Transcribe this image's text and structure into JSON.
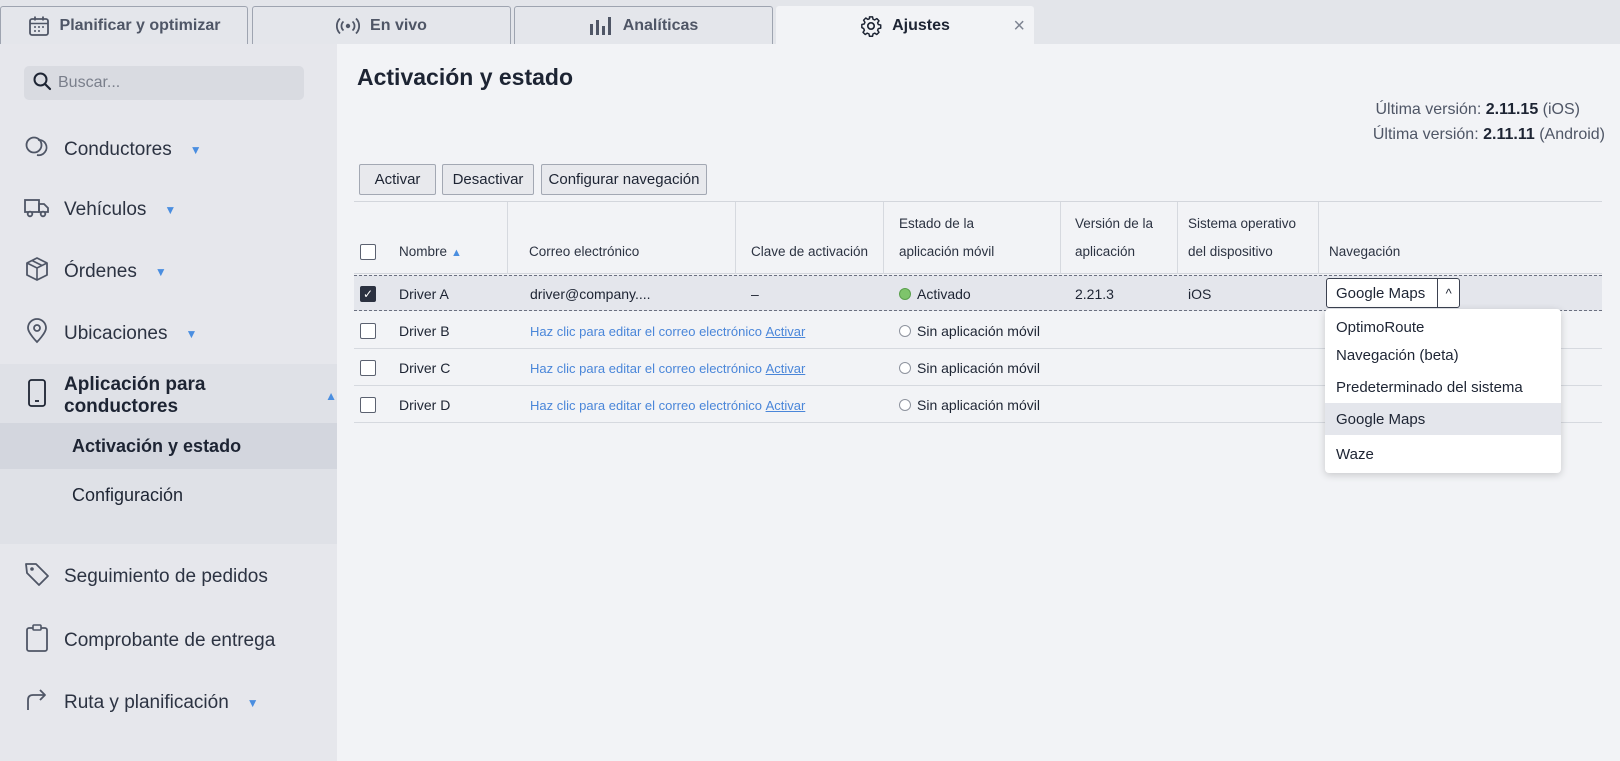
{
  "tabs": [
    {
      "label": "Planificar y optimizar",
      "icon": "calendar-icon"
    },
    {
      "label": "En vivo",
      "icon": "broadcast-icon"
    },
    {
      "label": "Analíticas",
      "icon": "bar-chart-icon"
    },
    {
      "label": "Ajustes",
      "icon": "gear-icon",
      "active": true
    }
  ],
  "sidebar": {
    "search_placeholder": "Buscar...",
    "items": [
      {
        "label": "Conductores",
        "icon": "drivers-icon"
      },
      {
        "label": "Vehículos",
        "icon": "truck-icon"
      },
      {
        "label": "Órdenes",
        "icon": "package-icon"
      },
      {
        "label": "Ubicaciones",
        "icon": "pin-icon"
      },
      {
        "label": "Aplicación para conductores",
        "icon": "phone-icon"
      },
      {
        "label": "Seguimiento de pedidos",
        "icon": "tag-icon"
      },
      {
        "label": "Comprobante de entrega",
        "icon": "clipboard-icon"
      },
      {
        "label": "Ruta y planificación",
        "icon": "route-arrow-icon"
      }
    ],
    "subitems": [
      "Activación y estado",
      "Configuración"
    ]
  },
  "main": {
    "title": "Activación y estado",
    "version_prefix": "Última versión:",
    "versions": [
      {
        "number": "2.11.15",
        "platform": "(iOS)"
      },
      {
        "number": "2.11.11",
        "platform": "(Android)"
      }
    ],
    "buttons": {
      "activate": "Activar",
      "deactivate": "Desactivar",
      "configure_nav": "Configurar navegación"
    }
  },
  "table": {
    "headers": {
      "name": "Nombre",
      "email": "Correo electrónico",
      "key": "Clave de activación",
      "app_state_1": "Estado de la",
      "app_state_2": "aplicación móvil",
      "version_1": "Versión de la",
      "version_2": "aplicación",
      "os_1": "Sistema operativo",
      "os_2": "del dispositivo",
      "navigation": "Navegación"
    },
    "rows": [
      {
        "name": "Driver A",
        "email": "driver@company....",
        "key": "–",
        "state": "Activado",
        "version": "2.21.3",
        "os": "iOS",
        "nav": "Google Maps",
        "checked": true
      },
      {
        "name": "Driver B",
        "email_link": "Haz clic para editar el correo electrónico",
        "activate_link": "Activar",
        "state": "Sin aplicación móvil"
      },
      {
        "name": "Driver C",
        "email_link": "Haz clic para editar el correo electrónico",
        "activate_link": "Activar",
        "state": "Sin aplicación móvil"
      },
      {
        "name": "Driver D",
        "email_link": "Haz clic para editar el correo electrónico",
        "activate_link": "Activar",
        "state": "Sin aplicación móvil"
      }
    ]
  },
  "dropdown": {
    "selected": "Google Maps",
    "options": [
      "OptimoRoute",
      "Navegación (beta)",
      "Predeterminado del sistema",
      "Google Maps",
      "Waze"
    ]
  },
  "colors": {
    "accent": "#4a8ee0",
    "link": "#4a86d9",
    "active_status": "#7ec46b"
  }
}
